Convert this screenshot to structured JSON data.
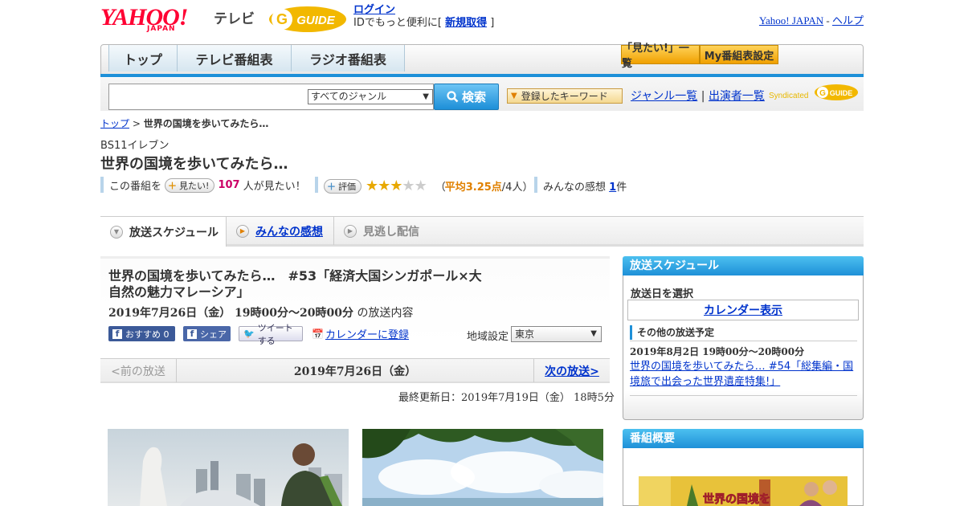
{
  "header": {
    "logo_yahoo": "YAHOO!",
    "logo_japan": "JAPAN",
    "logo_tv": "テレビ",
    "logo_gguide": "GUIDE",
    "login": "ログイン",
    "login_sub": "IDでもっと便利に[",
    "signup": "新規取得",
    "login_sub_end": "]",
    "yahoo_japan": "Yahoo! JAPAN",
    "sep": "-",
    "help": "ヘルプ"
  },
  "nav": {
    "top": "トップ",
    "tv": "テレビ番組表",
    "radio": "ラジオ番組表",
    "watchlist": "「見たい!」一覧",
    "my_settings": "My番組表設定"
  },
  "search": {
    "genre": "すべてのジャンル",
    "button": "検索",
    "keywords": "登録したキーワード",
    "genre_list": "ジャンル一覧",
    "divider": "|",
    "performers": "出演者一覧",
    "syndicated": "Syndicated"
  },
  "breadcrumb": {
    "top": "トップ",
    "sep": ">",
    "current": "世界の国境を歩いてみたら…"
  },
  "program": {
    "station": "BS11イレブン",
    "title": "世界の国境を歩いてみたら…"
  },
  "rating": {
    "prefix": "この番組を",
    "want_btn": "見たい!",
    "want_count": "107",
    "want_suffix": "人が見たい！",
    "eval_btn": "評価",
    "stars": 3,
    "stars_max": 5,
    "avg_open": "（",
    "avg": "平均3.25点",
    "avg_people": "/4人）",
    "reviews_label": "みんなの感想",
    "reviews_count": "1",
    "reviews_unit": "件"
  },
  "tabs": {
    "schedule": "放送スケジュール",
    "reviews": "みんなの感想",
    "missed": "見逃し配信"
  },
  "episode": {
    "title_line1": "世界の国境を歩いてみたら…　#53「経済大国シンガポール×大",
    "title_line2": "自然の魅力マレーシア」",
    "datetime": "2019年7月26日（金）  19時00分～20時00分",
    "datetime_suffix": "の放送内容"
  },
  "share": {
    "recommend": "おすすめ 0",
    "fb_share": "シェア",
    "tweet": "ツイートする",
    "calendar": "カレンダーに登録",
    "region_label": "地域設定",
    "region": "東京"
  },
  "pager": {
    "prev": "<前の放送",
    "date": "2019年7月26日（金）",
    "next": "次の放送>"
  },
  "updated": "最終更新日：2019年7月19日（金）  18時5分",
  "sidebar": {
    "schedule_head": "放送スケジュール",
    "select_date": "放送日を選択",
    "calendar": "カレンダー表示",
    "other_head": "その他の放送予定",
    "next_datetime": "2019年8月2日  19時00分～20時00分",
    "next_title": "世界の国境を歩いてみたら…  #54「総集編・国境旅で出会った世界遺産特集!」",
    "overview_head": "番組概要",
    "overview_banner": "世界の国境を"
  },
  "colors": {
    "accent_blue": "#1e90d8",
    "link": "#0033cc",
    "yahoo_red": "#ff0033",
    "gguide_yellow": "#f2b800",
    "want_pink": "#cc0066",
    "star": "#e8a800"
  }
}
